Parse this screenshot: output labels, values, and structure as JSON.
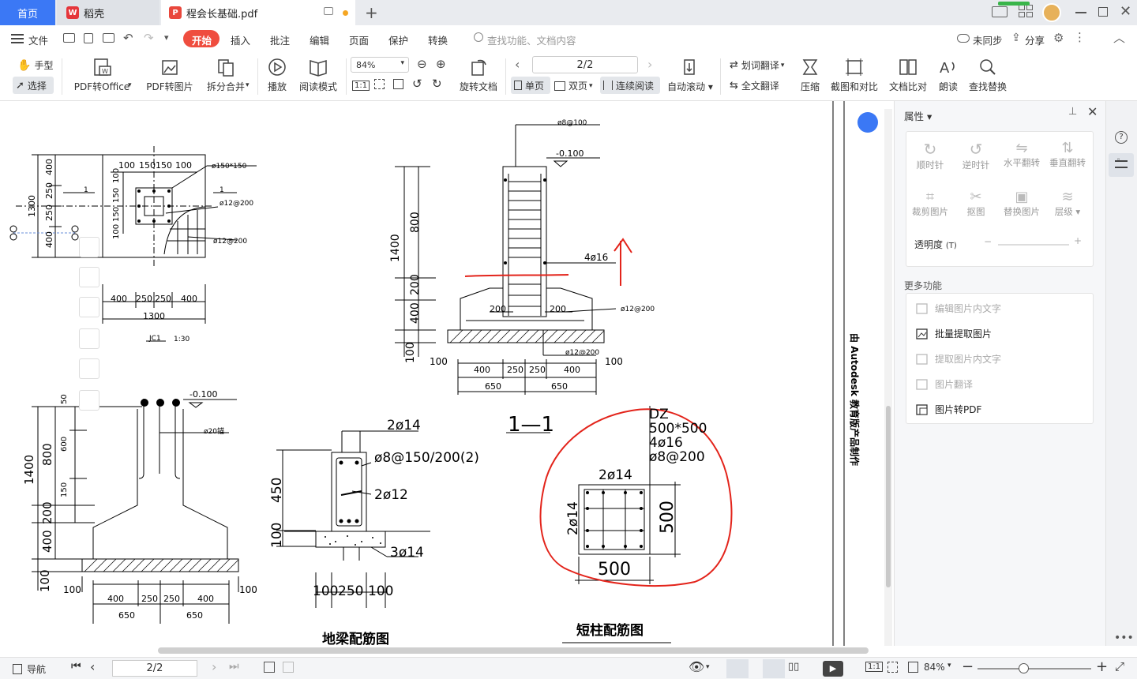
{
  "tabs": {
    "home": "首页",
    "daoke": "稻壳",
    "doc": "程会长基础.pdf"
  },
  "menu": {
    "file": "文件",
    "items": [
      "开始",
      "插入",
      "批注",
      "编辑",
      "页面",
      "保护",
      "转换"
    ],
    "search_placeholder": "查找功能、文档内容",
    "sync": "未同步",
    "share": "分享"
  },
  "ribbon": {
    "hand": "手型",
    "select": "选择",
    "pdf_office": "PDF转Office",
    "pdf_img": "PDF转图片",
    "split_merge": "拆分合并",
    "play": "播放",
    "read_mode": "阅读模式",
    "zoom": "84%",
    "page": "2/2",
    "rotate": "旋转文档",
    "single": "单页",
    "double": "双页",
    "continuous": "连续阅读",
    "autoscroll": "自动滚动",
    "word_trans": "划词翻译",
    "full_trans": "全文翻译",
    "compress": "压缩",
    "screenshot": "截图和对比",
    "doc_compare": "文档比对",
    "read_aloud": "朗读",
    "find_replace": "查找替换"
  },
  "drawing": {
    "jc1": {
      "dims_left": [
        "400",
        "250",
        "250",
        "400",
        "1300"
      ],
      "dims_top": [
        "100",
        "150",
        "150",
        "100"
      ],
      "dims_inner_left": [
        "100",
        "150",
        "150",
        "100"
      ],
      "dims_bottom": [
        "400",
        "250",
        "250",
        "400"
      ],
      "total": "1300",
      "ann1": "ø150*150",
      "ann2": "ø12@200",
      "ann3": "ø12@200",
      "sec": "1",
      "label": "JC1",
      "scale": "1:30"
    },
    "sec11": {
      "top": "ø8@100",
      "elev": "-0.100",
      "dims_left": [
        "800",
        "1400",
        "200",
        "400",
        "100"
      ],
      "rebar": "4ø16",
      "d200a": "200",
      "d200b": "200",
      "bot1": "ø12@200",
      "bot2": "ø12@200",
      "dims_bottom": [
        "100",
        "400",
        "250",
        "250",
        "400",
        "100"
      ],
      "dims_bottom2": [
        "650",
        "650"
      ],
      "title": "1—1"
    },
    "anchor": {
      "elev": "-0.100",
      "ann": "ø20锚",
      "dims_left": [
        "1400",
        "800",
        "200",
        "400",
        "100"
      ],
      "dims_inner": [
        "50",
        "600",
        "150"
      ],
      "dims_bottom": [
        "100",
        "400",
        "250",
        "250",
        "400",
        "100"
      ],
      "dims_bottom2": [
        "650",
        "650"
      ]
    },
    "beam": {
      "top": "2ø14",
      "stirrup": "ø8@150/200(2)",
      "mid": "2ø12",
      "bot": "3ø14",
      "h": "450",
      "b": "100",
      "dims_bottom": [
        "100",
        "250",
        "100"
      ],
      "title": "地梁配筋图"
    },
    "column": {
      "name": "DZ",
      "size": "500*500",
      "rebar": "4ø16",
      "stirrup": "ø8@200",
      "top": "2ø14",
      "side": "2ø14",
      "w": "500",
      "h": "500",
      "title": "短柱配筋图"
    },
    "watermark": "由 Autodesk 教育版产品制作"
  },
  "props": {
    "title": "属性",
    "btns": [
      "顺时针",
      "逆时针",
      "水平翻转",
      "垂直翻转",
      "裁剪图片",
      "抠图",
      "替换图片",
      "层级"
    ],
    "opacity": "透明度",
    "opacity_key": "(T)",
    "more": "更多功能",
    "more_items": [
      "编辑图片内文字",
      "批量提取图片",
      "提取图片内文字",
      "图片翻译",
      "图片转PDF"
    ]
  },
  "status": {
    "nav": "导航",
    "page": "2/2",
    "zoom": "84%"
  }
}
